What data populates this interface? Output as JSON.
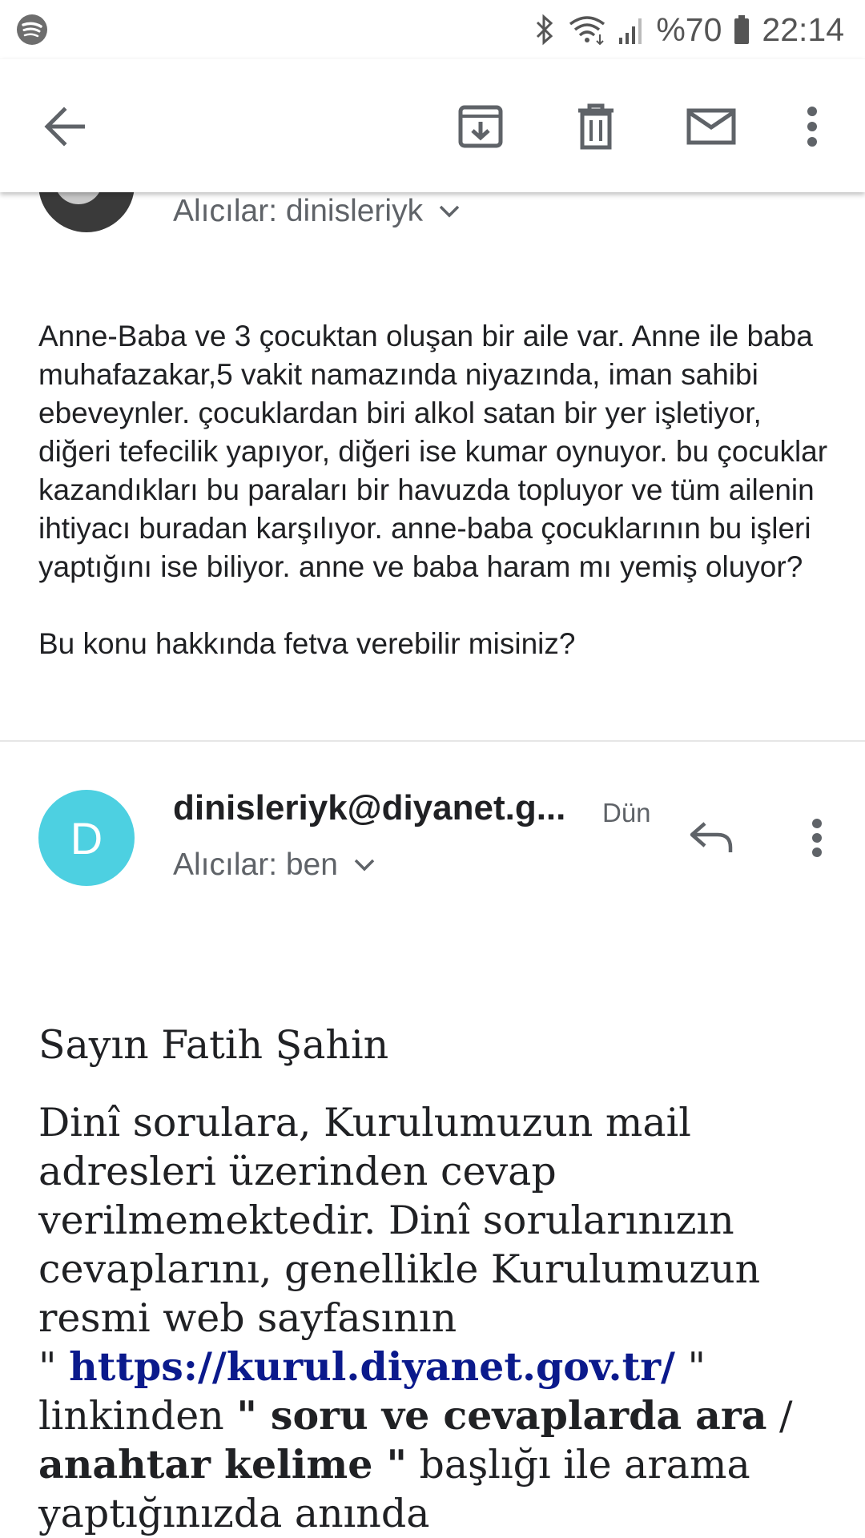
{
  "status_bar": {
    "battery_percent": "%70",
    "time": "22:14",
    "icons": [
      "spotify-icon",
      "bluetooth-icon",
      "wifi-icon",
      "signal-icon",
      "battery-icon"
    ]
  },
  "toolbar": {
    "icons": [
      "back-arrow-icon",
      "archive-icon",
      "delete-icon",
      "mail-icon",
      "more-vert-icon"
    ]
  },
  "message1": {
    "recipients": "Alıcılar: dinisleriyk",
    "body_paragraphs": [
      "Anne-Baba ve 3 çocuktan oluşan bir aile var. Anne ile baba muhafazakar,5 vakit namazında niyazında, iman sahibi ebeveynler. çocuklardan biri alkol satan bir yer işletiyor, diğeri tefecilik yapıyor, diğeri ise kumar oynuyor. bu çocuklar kazandıkları bu paraları bir havuzda topluyor ve tüm ailenin ihtiyacı buradan karşılıyor. anne-baba çocuklarının bu işleri yaptığını ise biliyor. anne ve baba haram mı yemiş oluyor?",
      "Bu konu hakkında fetva verebilir misiniz?"
    ]
  },
  "message2": {
    "avatar_letter": "D",
    "avatar_color": "#4dd0e1",
    "sender": "dinisleriyk@diyanet.g...",
    "date": "Dün",
    "recipients": "Alıcılar: ben",
    "greeting": "Sayın Fatih Şahin",
    "body_part1": "Dinî sorulara, Kurulumuzun  mail adresleri üzerinden  cevap verilmemektedir. Dinî sorularınızın cevaplarını, genellikle Kurulumuzun resmi web sayfasının",
    "quote_open": "\" ",
    "link": "https://kurul.diyanet.gov.tr/",
    "quote_close": " \"",
    "body_part2": "linkinden ",
    "bold_phrase": "\" soru ve cevaplarda ara",
    "slash": " / ",
    "bold_phrase2": "anahtar kelime \"",
    "body_part3": " başlığı ile arama yaptığınızda anında"
  },
  "colors": {
    "link": "#0b1a8c",
    "avatar": "#4dd0e1",
    "secondary_text": "#5f6368"
  }
}
